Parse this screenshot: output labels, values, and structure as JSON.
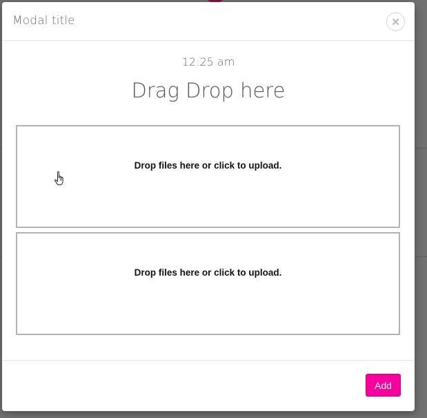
{
  "modal": {
    "title": "Modal title",
    "close_icon": "close-icon"
  },
  "body": {
    "time": "12:25 am",
    "heading": "Drag Drop here",
    "dropzones": [
      {
        "message": "Drop files here or click to upload."
      },
      {
        "message": "Drop files here or click to upload."
      }
    ],
    "cursor_icon": "hand-pointer-icon"
  },
  "footer": {
    "add_label": "Add",
    "accent_color": "#f7009d"
  }
}
